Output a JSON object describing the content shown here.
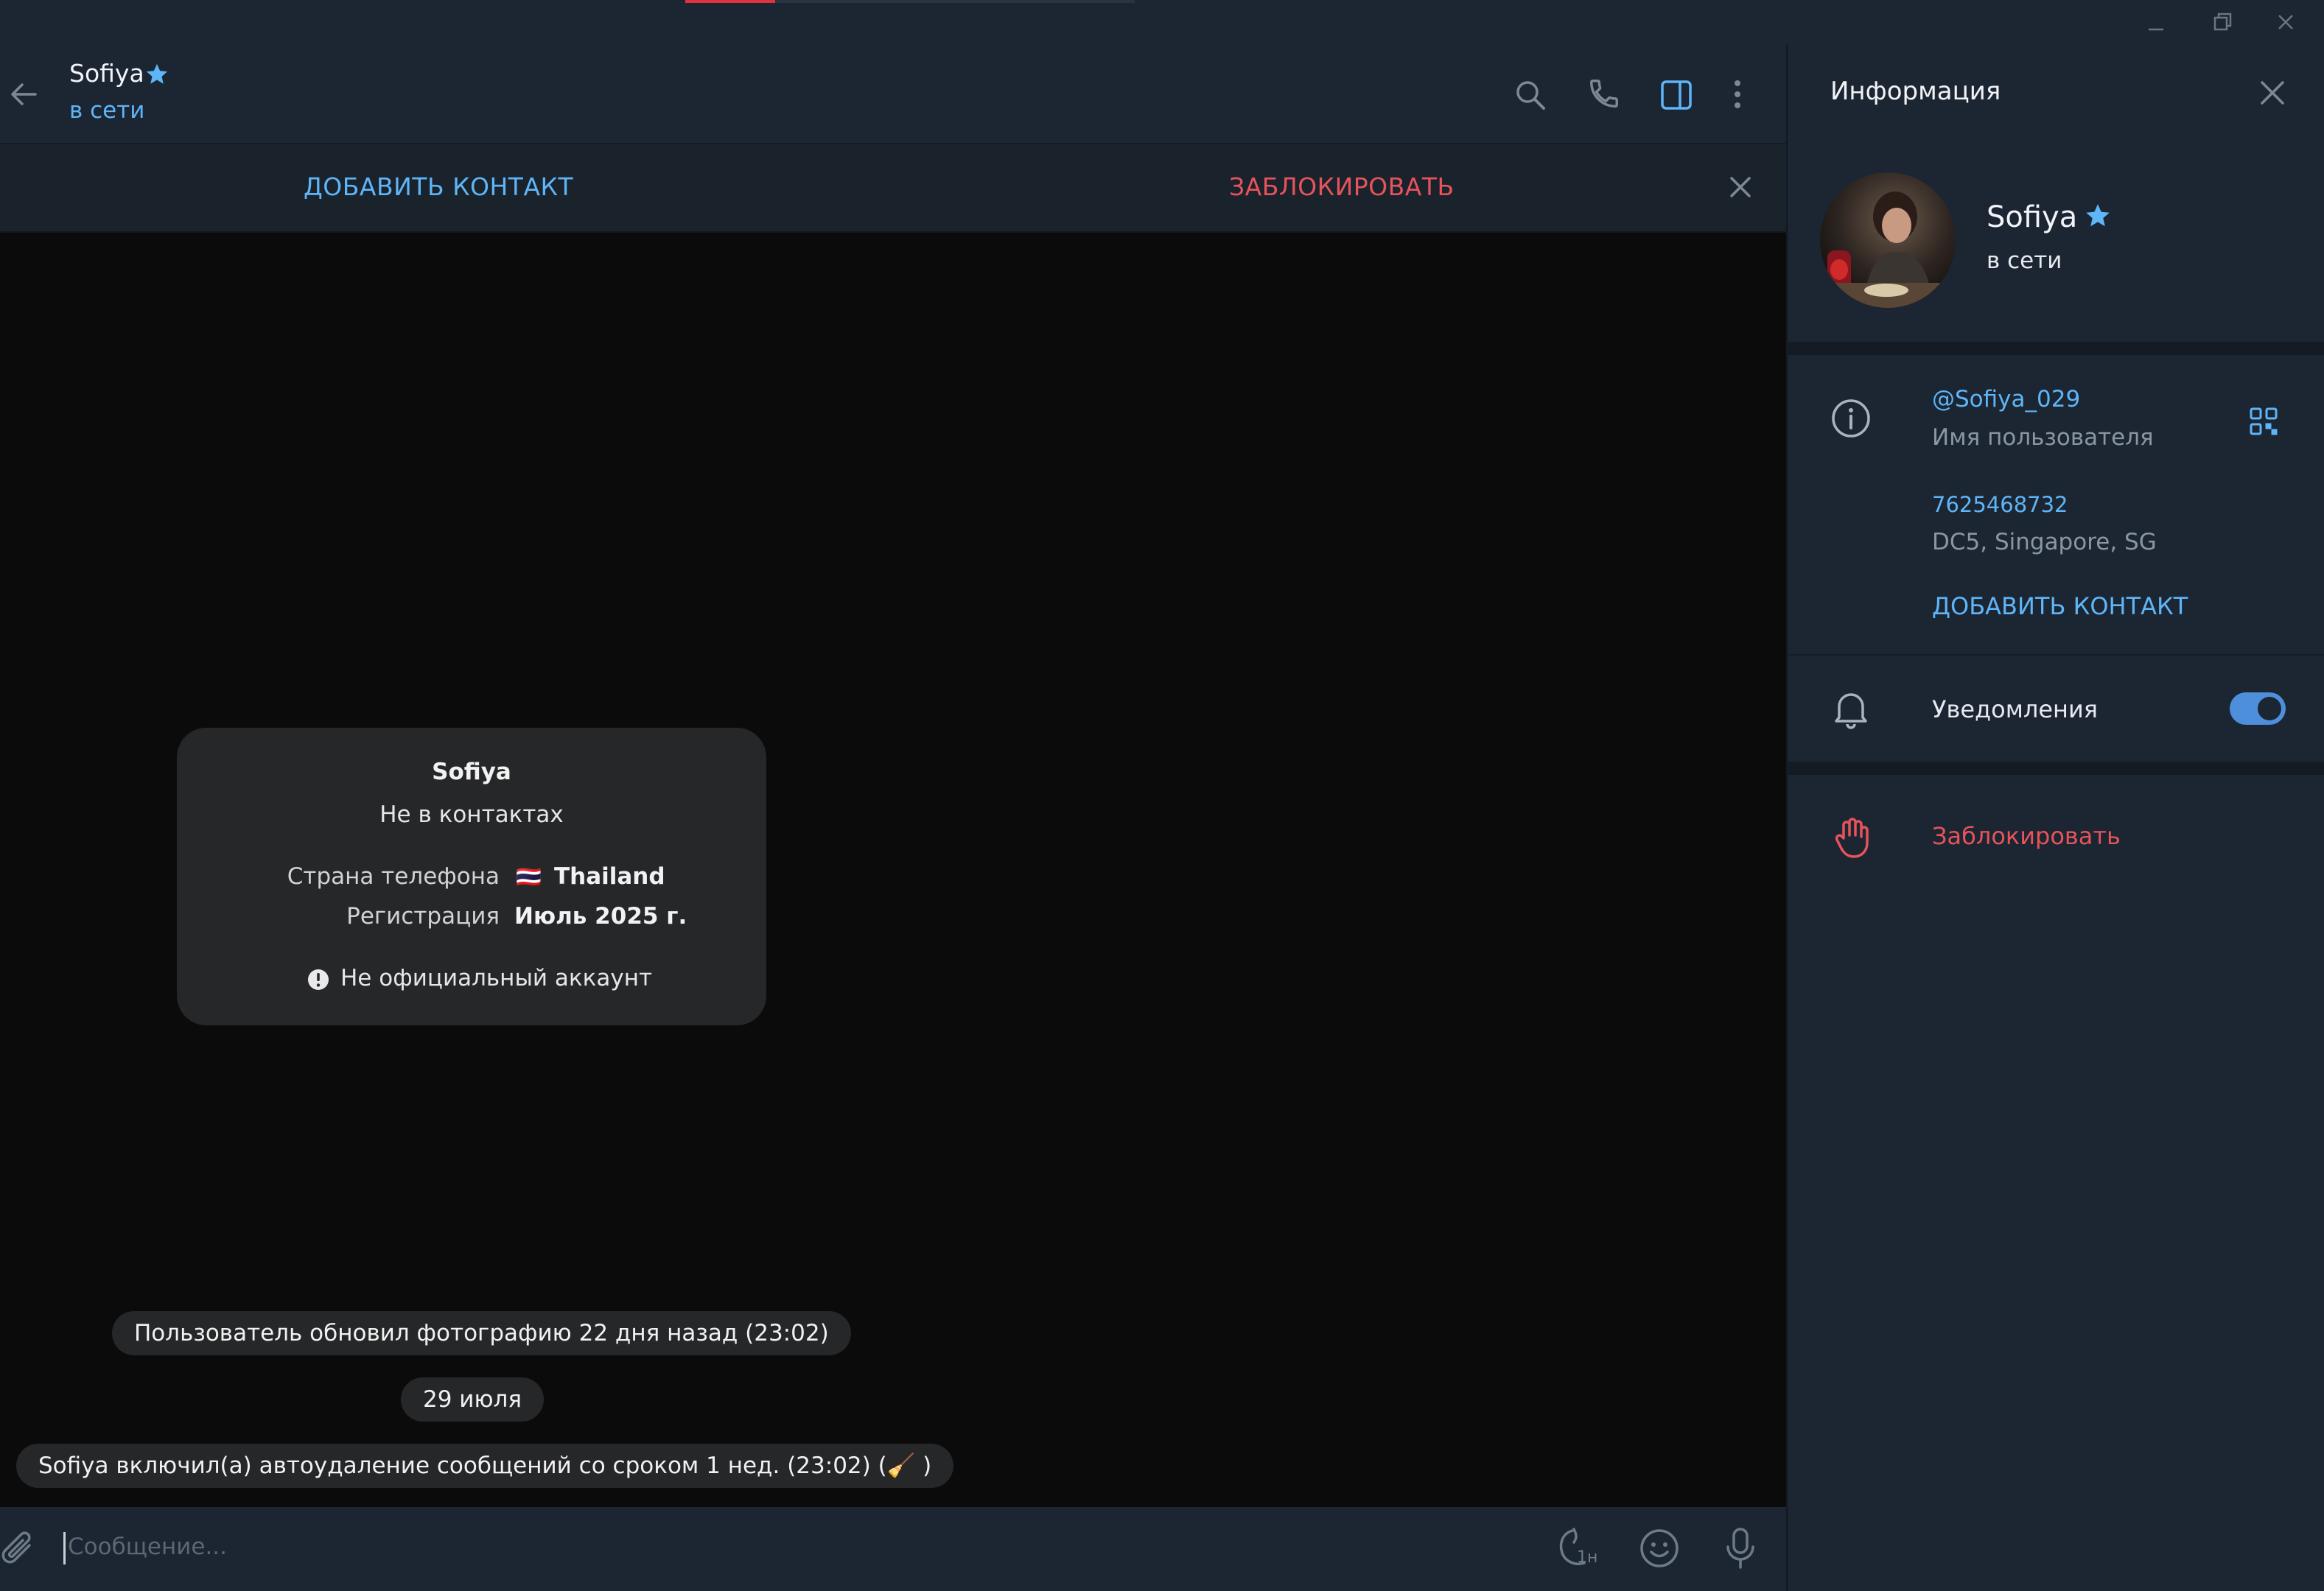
{
  "window": {
    "minimize_icon": "minimize-icon",
    "restore_icon": "restore-icon",
    "close_icon": "close-icon",
    "progress_color": "#e0343d"
  },
  "chat_header": {
    "name": "Sofiya",
    "status": "в сети",
    "badge_icon": "star-badge-icon",
    "icons": [
      "back-arrow-icon",
      "search-icon",
      "phone-icon",
      "sidebar-toggle-icon",
      "more-vert-icon"
    ]
  },
  "action_bar": {
    "add_contact": "ДОБАВИТЬ КОНТАКТ",
    "block": "ЗАБЛОКИРОВАТЬ"
  },
  "info_card": {
    "name": "Sofiya",
    "subtitle": "Не в контактах",
    "country_label": "Страна телефона",
    "country_flag": "🇹🇭",
    "country_value": "Thailand",
    "registration_label": "Регистрация",
    "registration_value": "Июль 2025 г.",
    "notice": "Не официальный аккаунт"
  },
  "service_messages": {
    "photo_update": "Пользователь обновил фотографию 22 дня назад (23:02)",
    "date": "29 июля",
    "autodelete": "Sofiya включил(а) автоудаление сообщений со сроком 1 нед. (23:02) (🧹 )"
  },
  "composer": {
    "placeholder": "Сообщение...",
    "timer_badge": "1н",
    "icons": [
      "attach-icon",
      "autodelete-timer-icon",
      "emoji-icon",
      "microphone-icon"
    ]
  },
  "info_panel": {
    "title": "Информация",
    "name": "Sofiya",
    "status": "в сети",
    "username": "@Sofiya_029",
    "username_label": "Имя пользователя",
    "user_id": "7625468732",
    "datacenter": "DC5, Singapore, SG",
    "add_contact": "ДОБАВИТЬ КОНТАКТ",
    "notifications_label": "Уведомления",
    "notifications_on": true,
    "block": "Заблокировать"
  },
  "colors": {
    "accent": "#5eb5f7",
    "danger": "#e5535b",
    "toggle": "#4e8fdc",
    "header_bg": "#1c2532",
    "chat_bg": "#0b0b0c"
  }
}
